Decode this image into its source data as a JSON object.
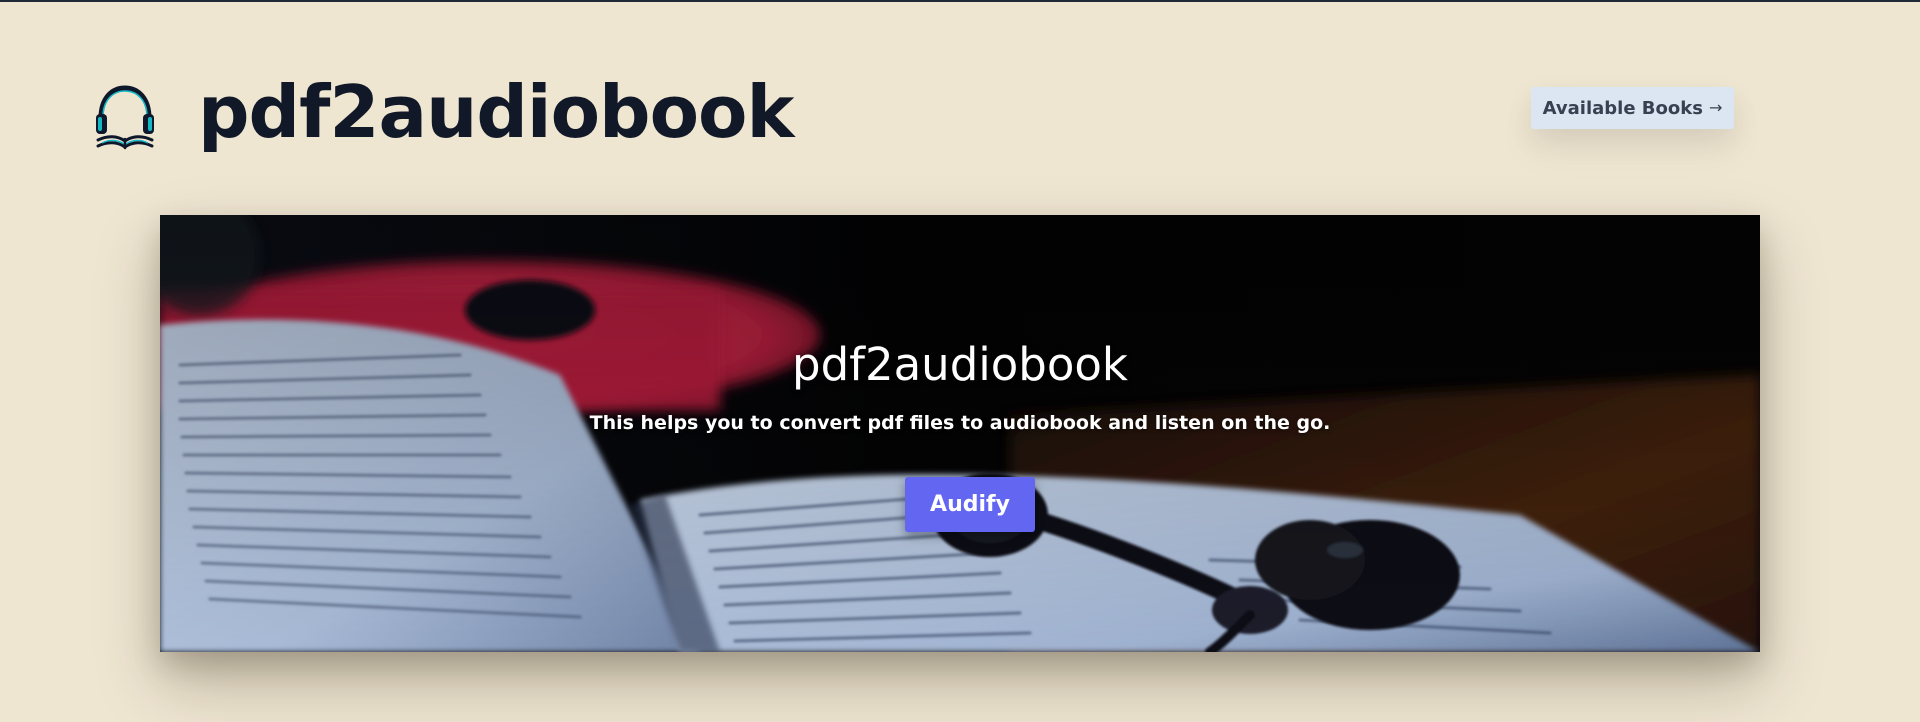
{
  "header": {
    "logo_icon": "headphones-book-icon",
    "site_title": "pdf2audiobook",
    "nav_link_label": "Available Books",
    "nav_link_icon": "arrow-right-icon"
  },
  "hero": {
    "background_image": "book-with-earphones-photo",
    "title": "pdf2audiobook",
    "subtitle": "This helps you to convert pdf files to audiobook and listen on the go.",
    "cta_label": "Audify"
  },
  "colors": {
    "page_background": "#EFE6D2",
    "title_text": "#111827",
    "nav_link_background": "#DCE6F2",
    "cta_background": "#6366F1",
    "logo_accent": "#14B8C4"
  }
}
